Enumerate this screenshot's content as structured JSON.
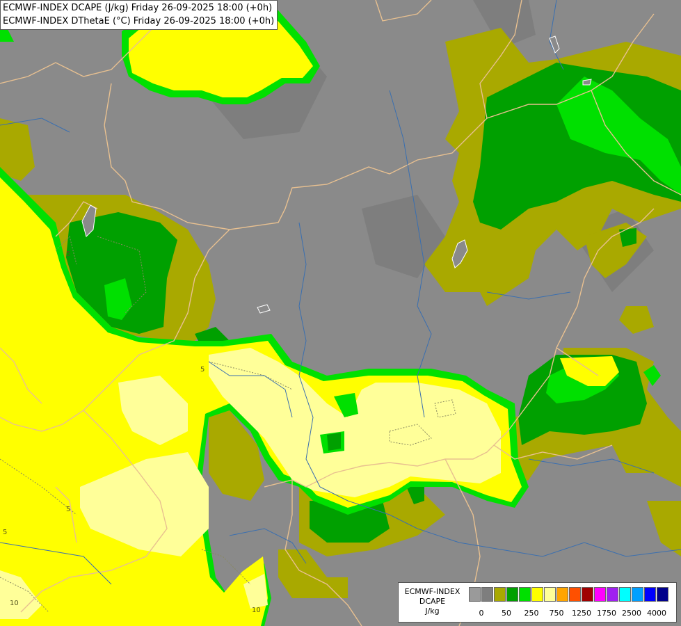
{
  "title": {
    "line1": "ECMWF-INDEX DCAPE (J/kg) Friday 26-09-2025 18:00 (+0h)",
    "line2": "ECMWF-INDEX DThetaE (°C) Friday 26-09-2025 18:00 (+0h)"
  },
  "legend": {
    "model": "ECMWF-INDEX",
    "parameter": "DCAPE",
    "unit": "J/kg",
    "colors": [
      "#9a9a9a",
      "#7e7e7e",
      "#a9a900",
      "#00a000",
      "#00e000",
      "#ffff00",
      "#ffff99",
      "#ffa500",
      "#ff5000",
      "#a00000",
      "#ff00ff",
      "#a020f0",
      "#00ffff",
      "#00a0ff",
      "#0000ff",
      "#00008b"
    ],
    "ticks": [
      {
        "label": "0",
        "at": 1
      },
      {
        "label": "50",
        "at": 3
      },
      {
        "label": "250",
        "at": 5
      },
      {
        "label": "750",
        "at": 7
      },
      {
        "label": "1250",
        "at": 9
      },
      {
        "label": "1750",
        "at": 11
      },
      {
        "label": "2500",
        "at": 13
      },
      {
        "label": "4000",
        "at": 15
      }
    ]
  },
  "contour_labels": [
    "5",
    "5",
    "5",
    "5",
    "10",
    "10"
  ],
  "colors": {
    "background": "#8a8a8a",
    "dark_gray": "#7e7e7e",
    "olive": "#a9a900",
    "dark_green": "#00a000",
    "green": "#00e000",
    "yellow": "#ffff00",
    "light_yellow": "#ffff99",
    "border": "#e8c090",
    "river": "#3a6fb0"
  }
}
